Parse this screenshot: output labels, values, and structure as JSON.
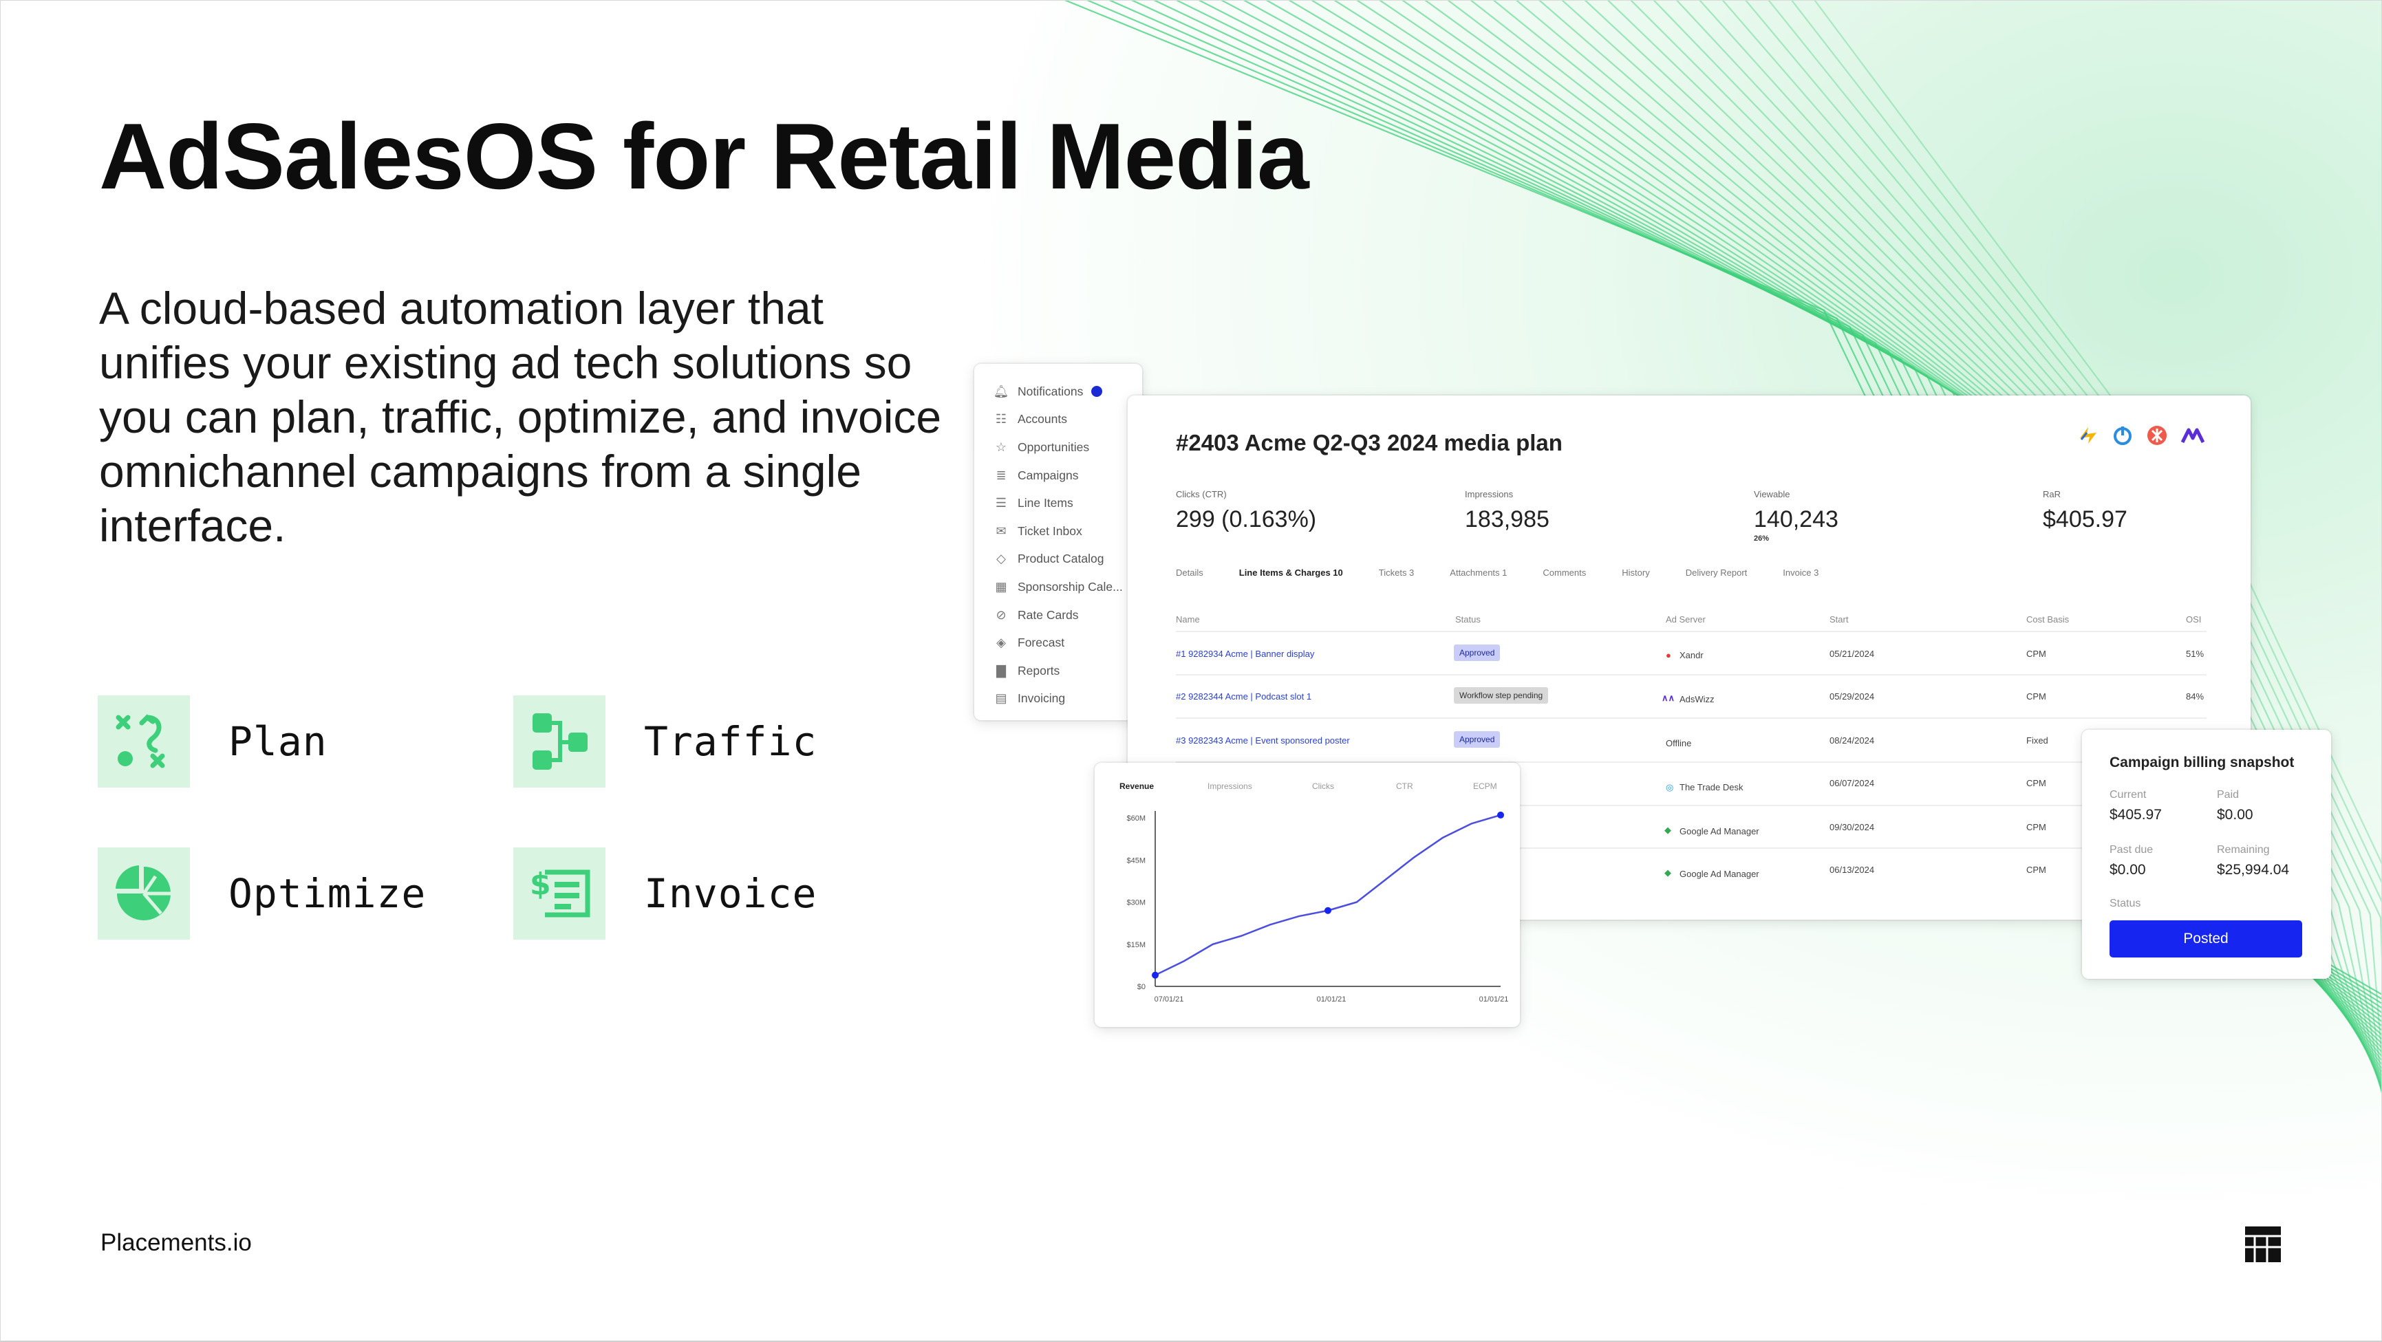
{
  "slide": {
    "title": "AdSalesOS for Retail Media",
    "subtitle": "A cloud-based automation layer that unifies your existing ad tech solutions so you can plan, traffic, optimize, and invoice omnichannel campaigns from a single interface.",
    "footer_brand": "Placements.io"
  },
  "features": [
    {
      "label": "Plan",
      "icon": "plan-icon"
    },
    {
      "label": "Traffic",
      "icon": "traffic-icon"
    },
    {
      "label": "Optimize",
      "icon": "optimize-icon"
    },
    {
      "label": "Invoice",
      "icon": "invoice-icon"
    }
  ],
  "colors": {
    "accent_green": "#3ecf7a",
    "icon_bg": "#d9f5e1",
    "primary_blue": "#1626f0",
    "line_blue": "#4b4ee0"
  },
  "sidebar": {
    "items": [
      {
        "label": "Notifications",
        "icon": "bell-icon"
      },
      {
        "label": "Accounts",
        "icon": "accounts-icon"
      },
      {
        "label": "Opportunities",
        "icon": "star-icon"
      },
      {
        "label": "Campaigns",
        "icon": "campaigns-icon"
      },
      {
        "label": "Line Items",
        "icon": "list-icon"
      },
      {
        "label": "Ticket Inbox",
        "icon": "inbox-icon"
      },
      {
        "label": "Product Catalog",
        "icon": "tag-icon"
      },
      {
        "label": "Sponsorship Cale...",
        "icon": "calendar-icon"
      },
      {
        "label": "Rate Cards",
        "icon": "rate-card-icon"
      },
      {
        "label": "Forecast",
        "icon": "layers-icon"
      },
      {
        "label": "Reports",
        "icon": "bar-chart-icon"
      },
      {
        "label": "Invoicing",
        "icon": "invoice-icon"
      }
    ]
  },
  "plan": {
    "title": "#2403 Acme Q2-Q3 2024 media plan",
    "metrics": [
      {
        "label": "Clicks (CTR)",
        "value": "299 (0.163%)",
        "sub": ""
      },
      {
        "label": "Impressions",
        "value": "183,985",
        "sub": ""
      },
      {
        "label": "Viewable",
        "value": "140,243",
        "sub": "26%"
      },
      {
        "label": "RaR",
        "value": "$405.97",
        "sub": ""
      }
    ],
    "tabs": [
      "Details",
      "Line Items & Charges 10",
      "Tickets 3",
      "Attachments 1",
      "Comments",
      "History",
      "Delivery Report",
      "Invoice 3"
    ],
    "table": {
      "headers": [
        "Name",
        "Status",
        "Ad Server",
        "Start",
        "Cost Basis",
        "OSI"
      ],
      "rows": [
        {
          "name": "#1 9282934 Acme | Banner display",
          "status": "Approved",
          "ad_server": "Xandr",
          "start": "05/21/2024",
          "cost_basis": "CPM",
          "osi": "51%"
        },
        {
          "name": "#2 9282344 Acme | Podcast slot 1",
          "status": "Workflow step pending",
          "ad_server": "AdsWizz",
          "start": "05/29/2024",
          "cost_basis": "CPM",
          "osi": "84%"
        },
        {
          "name": "#3 9282343 Acme | Event sponsored poster",
          "status": "Approved",
          "ad_server": "Offline",
          "start": "08/24/2024",
          "cost_basis": "Fixed",
          "osi": ""
        },
        {
          "name": "",
          "status": "",
          "ad_server": "The Trade Desk",
          "start": "06/07/2024",
          "cost_basis": "CPM",
          "osi": ""
        },
        {
          "name": "",
          "status": "",
          "ad_server": "Google Ad Manager",
          "start": "09/30/2024",
          "cost_basis": "CPM",
          "osi": ""
        },
        {
          "name": "",
          "status": "",
          "ad_server": "Google Ad Manager",
          "start": "06/13/2024",
          "cost_basis": "CPM",
          "osi": ""
        }
      ]
    }
  },
  "chart": {
    "tabs": [
      "Revenue",
      "Impressions",
      "Clicks",
      "CTR",
      "ECPM"
    ]
  },
  "chart_data": {
    "type": "line",
    "title": "",
    "xlabel": "",
    "ylabel": "",
    "ylim": [
      0,
      60
    ],
    "y_ticks": [
      "$0",
      "$15M",
      "$30M",
      "$45M",
      "$60M"
    ],
    "x_ticks": [
      "07/01/21",
      "01/01/21",
      "01/01/21"
    ],
    "series": [
      {
        "values": [
          4,
          9,
          15,
          18,
          22,
          25,
          27,
          30,
          38,
          46,
          53,
          58,
          61
        ]
      }
    ],
    "markers": [
      0,
      6,
      12
    ],
    "grid": false
  },
  "billing": {
    "title": "Campaign billing snapshot",
    "current_label": "Current",
    "current_value": "$405.97",
    "paid_label": "Paid",
    "paid_value": "$0.00",
    "past_due_label": "Past due",
    "past_due_value": "$0.00",
    "remaining_label": "Remaining",
    "remaining_value": "$25,994.04",
    "status_label": "Status",
    "status_button": "Posted"
  }
}
